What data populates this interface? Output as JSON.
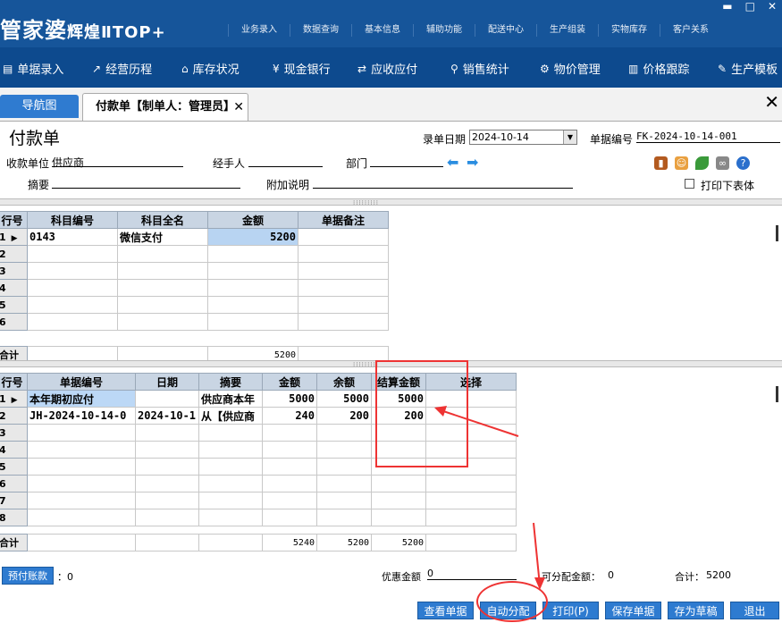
{
  "app": {
    "logo_main": "管家婆",
    "logo_sub": "辉煌ⅡTOP+",
    "top_menu": [
      "业务录入",
      "数据查询",
      "基本信息",
      "辅助功能",
      "配送中心",
      "生产组装",
      "实物库存",
      "客户关系"
    ],
    "window_controls": [
      "▬",
      "□",
      "✕"
    ]
  },
  "toolbar": [
    {
      "icon": "doc-icon",
      "glyph": "▤",
      "label": "单据录入"
    },
    {
      "icon": "chart-icon",
      "glyph": "↗",
      "label": "经营历程"
    },
    {
      "icon": "home-icon",
      "glyph": "⌂",
      "label": "库存状况"
    },
    {
      "icon": "yen-icon",
      "glyph": "¥",
      "label": "现金银行"
    },
    {
      "icon": "exchange-icon",
      "glyph": "⇄",
      "label": "应收应付"
    },
    {
      "icon": "search-icon",
      "glyph": "⚲",
      "label": "销售统计"
    },
    {
      "icon": "gear-icon",
      "glyph": "⚙",
      "label": "物价管理"
    },
    {
      "icon": "bar-icon",
      "glyph": "▥",
      "label": "价格跟踪"
    },
    {
      "icon": "wrench-icon",
      "glyph": "✎",
      "label": "生产模板"
    }
  ],
  "tabs": {
    "nav": "导航图",
    "active": "付款单【制单人：管理员】",
    "close": "✕",
    "close_all": "✕"
  },
  "form": {
    "title": "付款单",
    "date_label": "录单日期",
    "date_value": "2024-10-14",
    "bill_no_label": "单据编号",
    "bill_no_value": "FK-2024-10-14-001",
    "payee_label": "收款单位",
    "payee_value": "供应商",
    "handler_label": "经手人",
    "dept_label": "部门",
    "summary_label": "摘要",
    "note_label": "附加说明",
    "print_table_label": "打印下表体"
  },
  "grid1": {
    "headers": [
      "行号",
      "科目编号",
      "科目全名",
      "金额",
      "单据备注"
    ],
    "rows": [
      {
        "n": "1",
        "code": "0143",
        "name": "微信支付",
        "amount": "5200",
        "remark": ""
      },
      {
        "n": "2",
        "code": "",
        "name": "",
        "amount": "",
        "remark": ""
      },
      {
        "n": "3",
        "code": "",
        "name": "",
        "amount": "",
        "remark": ""
      },
      {
        "n": "4",
        "code": "",
        "name": "",
        "amount": "",
        "remark": ""
      },
      {
        "n": "5",
        "code": "",
        "name": "",
        "amount": "",
        "remark": ""
      },
      {
        "n": "6",
        "code": "",
        "name": "",
        "amount": "",
        "remark": ""
      }
    ],
    "total_label": "合计",
    "total_amount": "5200"
  },
  "grid2": {
    "headers": [
      "行号",
      "单据编号",
      "日期",
      "摘要",
      "金额",
      "余额",
      "结算金额",
      "选择"
    ],
    "rows": [
      {
        "n": "1",
        "bill": "本年期初应付",
        "date": "",
        "summary": "供应商本年",
        "amount": "5000",
        "balance": "5000",
        "settle": "5000",
        "select": ""
      },
      {
        "n": "2",
        "bill": "JH-2024-10-14-0",
        "date": "2024-10-1",
        "summary": "从【供应商",
        "amount": "240",
        "balance": "200",
        "settle": "200",
        "select": ""
      },
      {
        "n": "3",
        "bill": "",
        "date": "",
        "summary": "",
        "amount": "",
        "balance": "",
        "settle": "",
        "select": ""
      },
      {
        "n": "4",
        "bill": "",
        "date": "",
        "summary": "",
        "amount": "",
        "balance": "",
        "settle": "",
        "select": ""
      },
      {
        "n": "5",
        "bill": "",
        "date": "",
        "summary": "",
        "amount": "",
        "balance": "",
        "settle": "",
        "select": ""
      },
      {
        "n": "6",
        "bill": "",
        "date": "",
        "summary": "",
        "amount": "",
        "balance": "",
        "settle": "",
        "select": ""
      },
      {
        "n": "7",
        "bill": "",
        "date": "",
        "summary": "",
        "amount": "",
        "balance": "",
        "settle": "",
        "select": ""
      },
      {
        "n": "8",
        "bill": "",
        "date": "",
        "summary": "",
        "amount": "",
        "balance": "",
        "settle": "",
        "select": ""
      }
    ],
    "total_label": "合计",
    "total_amount": "5240",
    "total_balance": "5200",
    "total_settle": "5200"
  },
  "footer": {
    "prepay_button": "预付账款",
    "prepay_value": "：0",
    "discount_label": "优惠金额",
    "discount_value": "0",
    "allocatable_label": "可分配金额：",
    "allocatable_value": "0",
    "sum_label": "合计：",
    "sum_value": "5200"
  },
  "buttons": [
    "查看单据",
    "自动分配",
    "打印(P)",
    "保存单据",
    "存为草稿",
    "退出"
  ],
  "annotation_color": "#e33333"
}
